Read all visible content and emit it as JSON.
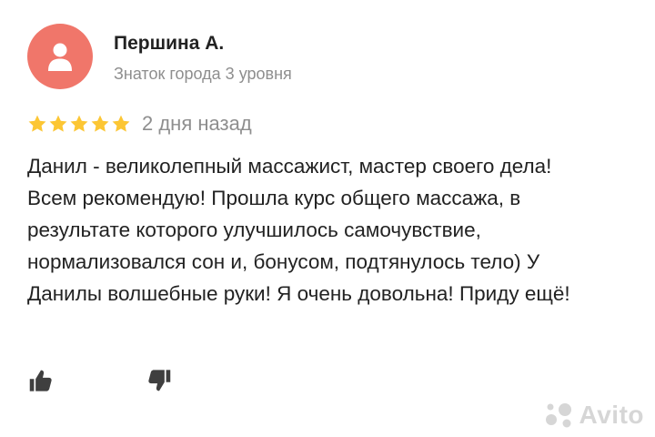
{
  "author": {
    "name": "Першина А.",
    "level": "Знаток города 3 уровня",
    "avatar_color": "#f0766a",
    "avatar_icon": "user-icon"
  },
  "rating": {
    "stars": 5,
    "max": 5,
    "star_color": "#fcc634",
    "date": "2 дня назад"
  },
  "review": {
    "text": "Данил - великолепный массажист, мастер своего дела! Всем рекомендую! Прошла курс общего массажа, в результате которого улучшилось самочувствие, нормализовался сон и, бонусом, подтянулось тело) У Данилы волшебные руки! Я очень довольна! Приду ещё!"
  },
  "reactions": {
    "like_icon": "thumbs-up-icon",
    "dislike_icon": "thumbs-down-icon"
  },
  "watermark": {
    "text": "Avito"
  }
}
